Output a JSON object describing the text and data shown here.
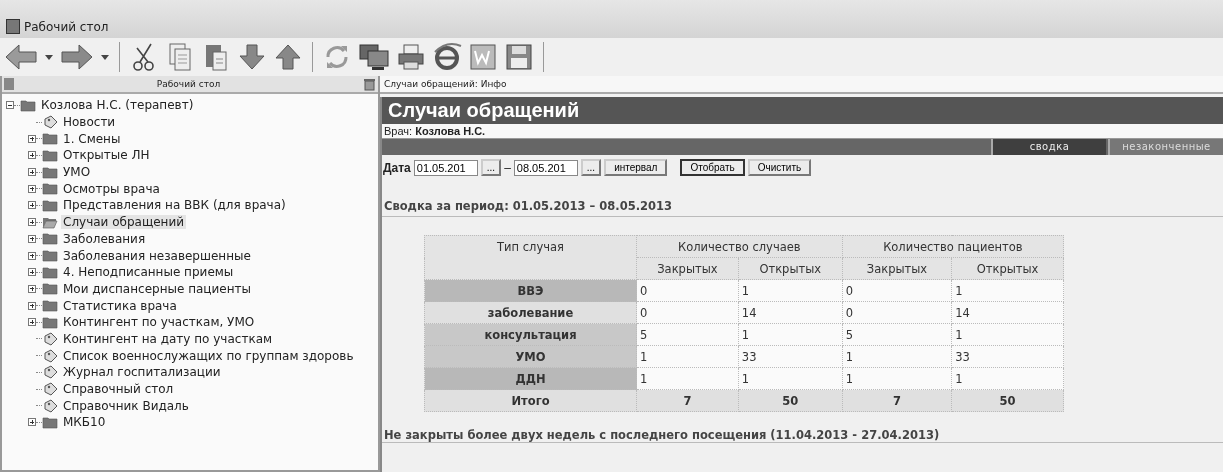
{
  "window": {
    "title": "Рабочий стол"
  },
  "sidebar": {
    "title": "Рабочий стол",
    "tree": [
      {
        "label": "Козлова Н.С. (терапевт)",
        "kind": "folder",
        "expanded": true,
        "selected": false,
        "children": [
          {
            "label": "Новости",
            "kind": "doc",
            "selected": false
          },
          {
            "label": "1. Смены",
            "kind": "folder",
            "expanded": false,
            "selected": false
          },
          {
            "label": "Открытые ЛН",
            "kind": "folder",
            "expanded": false,
            "selected": false
          },
          {
            "label": "УМО",
            "kind": "folder",
            "expanded": false,
            "selected": false
          },
          {
            "label": "Осмотры врача",
            "kind": "folder",
            "expanded": false,
            "selected": false
          },
          {
            "label": "Представления на ВВК (для врача)",
            "kind": "folder",
            "expanded": false,
            "selected": false
          },
          {
            "label": "Случаи обращений",
            "kind": "folder",
            "expanded": false,
            "selected": true
          },
          {
            "label": "Заболевания",
            "kind": "folder",
            "expanded": false,
            "selected": false
          },
          {
            "label": "Заболевания незавершенные",
            "kind": "folder",
            "expanded": false,
            "selected": false
          },
          {
            "label": "4. Неподписанные приемы",
            "kind": "folder",
            "expanded": false,
            "selected": false
          },
          {
            "label": "Мои диспансерные пациенты",
            "kind": "folder",
            "expanded": false,
            "selected": false
          },
          {
            "label": "Статистика врача",
            "kind": "folder",
            "expanded": false,
            "selected": false
          },
          {
            "label": "Контингент по участкам, УМО",
            "kind": "folder",
            "expanded": false,
            "selected": false
          },
          {
            "label": "Контингент на дату по участкам",
            "kind": "doc",
            "selected": false
          },
          {
            "label": "Список военнослужащих по группам здоровь",
            "kind": "doc",
            "selected": false
          },
          {
            "label": "Журнал госпитализации",
            "kind": "doc",
            "selected": false
          },
          {
            "label": "Справочный стол",
            "kind": "doc",
            "selected": false
          },
          {
            "label": "Справочник Видаль",
            "kind": "doc",
            "selected": false
          },
          {
            "label": "МКБ10",
            "kind": "folder",
            "expanded": false,
            "selected": false
          }
        ]
      }
    ]
  },
  "panel": {
    "title": "Случаи обращений: Инфо",
    "heading": "Случаи обращений",
    "doctor_label": "Врач:",
    "doctor": "Козлова Н.С.",
    "tabs": [
      {
        "label": "сводка",
        "selected": true
      },
      {
        "label": "незаконченные",
        "selected": false
      }
    ],
    "filter": {
      "label": "Дата",
      "from": "01.05.201",
      "pick": "...",
      "dash": "–",
      "to": "08.05.201",
      "pick2": "...",
      "buttons": [
        "интервал",
        "Отобрать",
        "Очистить"
      ]
    },
    "summary_title": "Сводка за период: 01.05.2013 – 08.05.2013",
    "table": {
      "type_heading": "Тип случая",
      "groups": [
        "Количество случаев",
        "Количество пациентов"
      ],
      "columns": [
        "Закрытых",
        "Открытых",
        "Закрытых",
        "Открытых"
      ],
      "rows": [
        {
          "type": "ВВЭ",
          "cells": [
            "0",
            "1",
            "0",
            "1"
          ]
        },
        {
          "type": "заболевание",
          "cells": [
            "0",
            "14",
            "0",
            "14"
          ]
        },
        {
          "type": "консультация",
          "cells": [
            "5",
            "1",
            "5",
            "1"
          ]
        },
        {
          "type": "УМО",
          "cells": [
            "1",
            "33",
            "1",
            "33"
          ]
        },
        {
          "type": "ДДН",
          "cells": [
            "1",
            "1",
            "1",
            "1"
          ]
        }
      ],
      "total": {
        "type": "Итого",
        "cells": [
          "7",
          "50",
          "7",
          "50"
        ]
      }
    },
    "unclosed_title": "Не закрыты более двух недель с последнего посещения (11.04.2013 - 27.04.2013)"
  }
}
